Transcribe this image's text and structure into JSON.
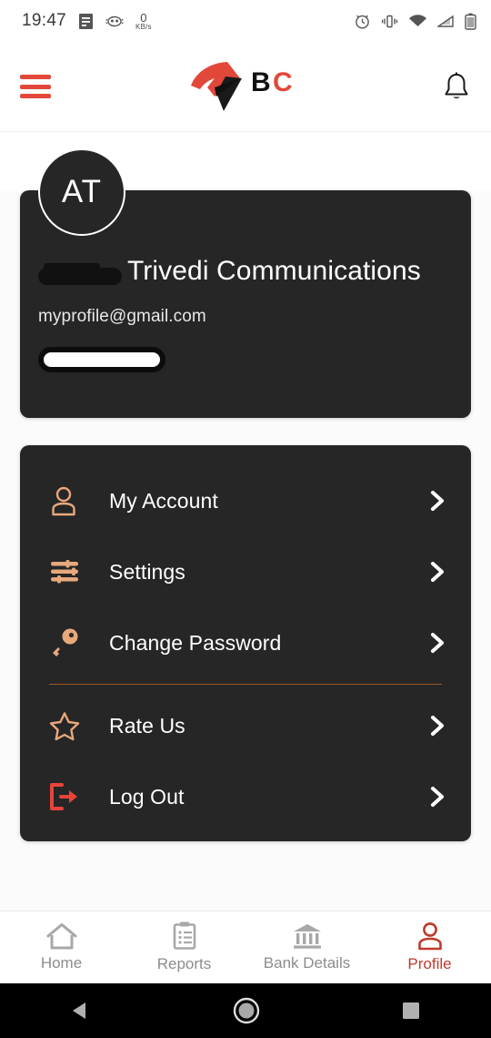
{
  "statusbar": {
    "time": "19:47",
    "network_speed_value": "0",
    "network_speed_unit": "KB/s",
    "left_icons": [
      "document-icon",
      "mask-icon"
    ],
    "right_icons": [
      "alarm-icon",
      "vibrate-icon",
      "wifi-icon",
      "signal-icon",
      "battery-icon"
    ]
  },
  "header": {
    "menu_icon": "hamburger-icon",
    "logo_text_black": "B",
    "logo_text_red": "C",
    "notification_icon": "bell-icon",
    "accent_red": "#e2483a"
  },
  "profile": {
    "avatar_initials": "AT",
    "company_name": "Trivedi Communications",
    "name_redacted": true,
    "email": "myprofile@gmail.com",
    "phone_redacted": true,
    "card_bg": "#262626"
  },
  "menu": {
    "items": [
      {
        "label": "My Account",
        "icon": "person-icon",
        "color": "#e8a87c",
        "chevron": "chevron-right-icon"
      },
      {
        "label": "Settings",
        "icon": "sliders-icon",
        "color": "#e8a87c",
        "chevron": "chevron-right-icon"
      },
      {
        "label": "Change Password",
        "icon": "key-icon",
        "color": "#e8a87c",
        "chevron": "chevron-right-icon"
      },
      {
        "label": "Rate Us",
        "icon": "star-icon",
        "color": "#e8a87c",
        "chevron": "chevron-right-icon"
      },
      {
        "label": "Log Out",
        "icon": "logout-icon",
        "color": "#e8443a",
        "chevron": "chevron-right-icon"
      }
    ],
    "divider_color": "#b5651d"
  },
  "bottom_nav": {
    "items": [
      {
        "label": "Home",
        "icon": "home-icon",
        "active": false
      },
      {
        "label": "Reports",
        "icon": "clipboard-icon",
        "active": false
      },
      {
        "label": "Bank Details",
        "icon": "bank-icon",
        "active": false
      },
      {
        "label": "Profile",
        "icon": "person-icon",
        "active": true
      }
    ],
    "active_color": "#c0392b",
    "inactive_color": "#8c8c8c"
  },
  "android_nav": {
    "back": "back-triangle-icon",
    "home": "home-circle-icon",
    "recents": "recents-square-icon"
  }
}
